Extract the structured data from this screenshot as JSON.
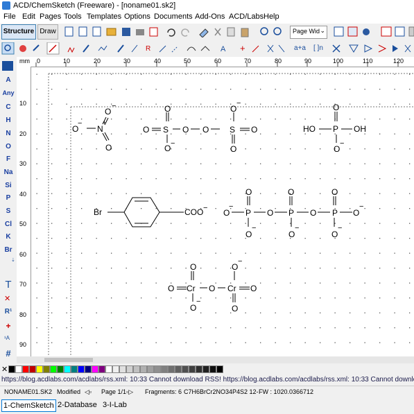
{
  "window": {
    "title": "ACD/ChemSketch (Freeware) - [noname01.sk2]"
  },
  "menu": [
    "File",
    "Edit",
    "Pages",
    "Tools",
    "Templates",
    "Options",
    "Documents",
    "Add-Ons",
    "ACD/Labs",
    "Help"
  ],
  "toolbar": {
    "structure_label": "Structure",
    "draw_label": "Draw",
    "zoom_value": "Page Wid"
  },
  "toolbar2": {
    "edges_label": "a+a",
    "brackets_label": "[ ]n"
  },
  "ruler": {
    "unit": "mm",
    "h_ticks": [
      "0",
      "10",
      "20",
      "30",
      "40",
      "50",
      "60",
      "70",
      "80",
      "90",
      "100",
      "110",
      "120"
    ],
    "v_ticks": [
      "10",
      "20",
      "30",
      "40",
      "50",
      "60",
      "70",
      "80",
      "90"
    ]
  },
  "left_toolbar": {
    "atoms": [
      "A",
      "Any",
      "C",
      "H",
      "N",
      "O",
      "F",
      "Na",
      "Si",
      "P",
      "S",
      "Cl",
      "K",
      "Br"
    ],
    "text_tool": "T",
    "r_tool": "R¹",
    "plus_tool": "+",
    "hash_tool": "#"
  },
  "structures": {
    "nitro": {
      "o_top": "O",
      "o_left": "O",
      "n": "N",
      "n_charge": "+",
      "o_bottom": "O",
      "minus": "−"
    },
    "peroxodisulfate": {
      "o": "O",
      "s": "S",
      "minus": "−"
    },
    "phosphoric": {
      "ho": "HO",
      "oh": "OH",
      "p": "P",
      "o": "O",
      "minus": "−"
    },
    "bromobenzoate": {
      "br": "Br",
      "coo": "COO",
      "minus": "−"
    },
    "triphosphate": {
      "o": "O",
      "p": "P",
      "minus": "−"
    },
    "dichromate": {
      "o": "O",
      "cr": "Cr",
      "minus": "−"
    }
  },
  "palette": [
    "#000000",
    "#ffffff",
    "#ff0000",
    "#c00000",
    "#ffff00",
    "#808000",
    "#00ff00",
    "#008000",
    "#00ffff",
    "#008080",
    "#0000ff",
    "#000080",
    "#ff00ff",
    "#800080",
    "#ffffff",
    "#f0f0f0",
    "#e0e0e0",
    "#d0d0d0",
    "#c0c0c0",
    "#b0b0b0",
    "#a0a0a0",
    "#909090",
    "#808080",
    "#707070",
    "#606060",
    "#505050",
    "#404040",
    "#303030",
    "#202020",
    "#101010",
    "#000000"
  ],
  "rss": "https://blog.acdlabs.com/acdlabs/rss.xml: 10:33 Cannot download RSS! https://blog.acdlabs.com/acdlabs/rss.xml: 10:33 Cannot download R",
  "status": {
    "file": "NONAME01.SK2",
    "modified": "Modified",
    "page": "Page 1/1",
    "fragments": "Fragments: 6",
    "formula": "C7H6BrCr2NO34P4S2 12-",
    "fw": "FW : 1020.0366712"
  },
  "tabs": [
    "1-ChemSketch",
    "2-Database",
    "3-I-Lab"
  ]
}
